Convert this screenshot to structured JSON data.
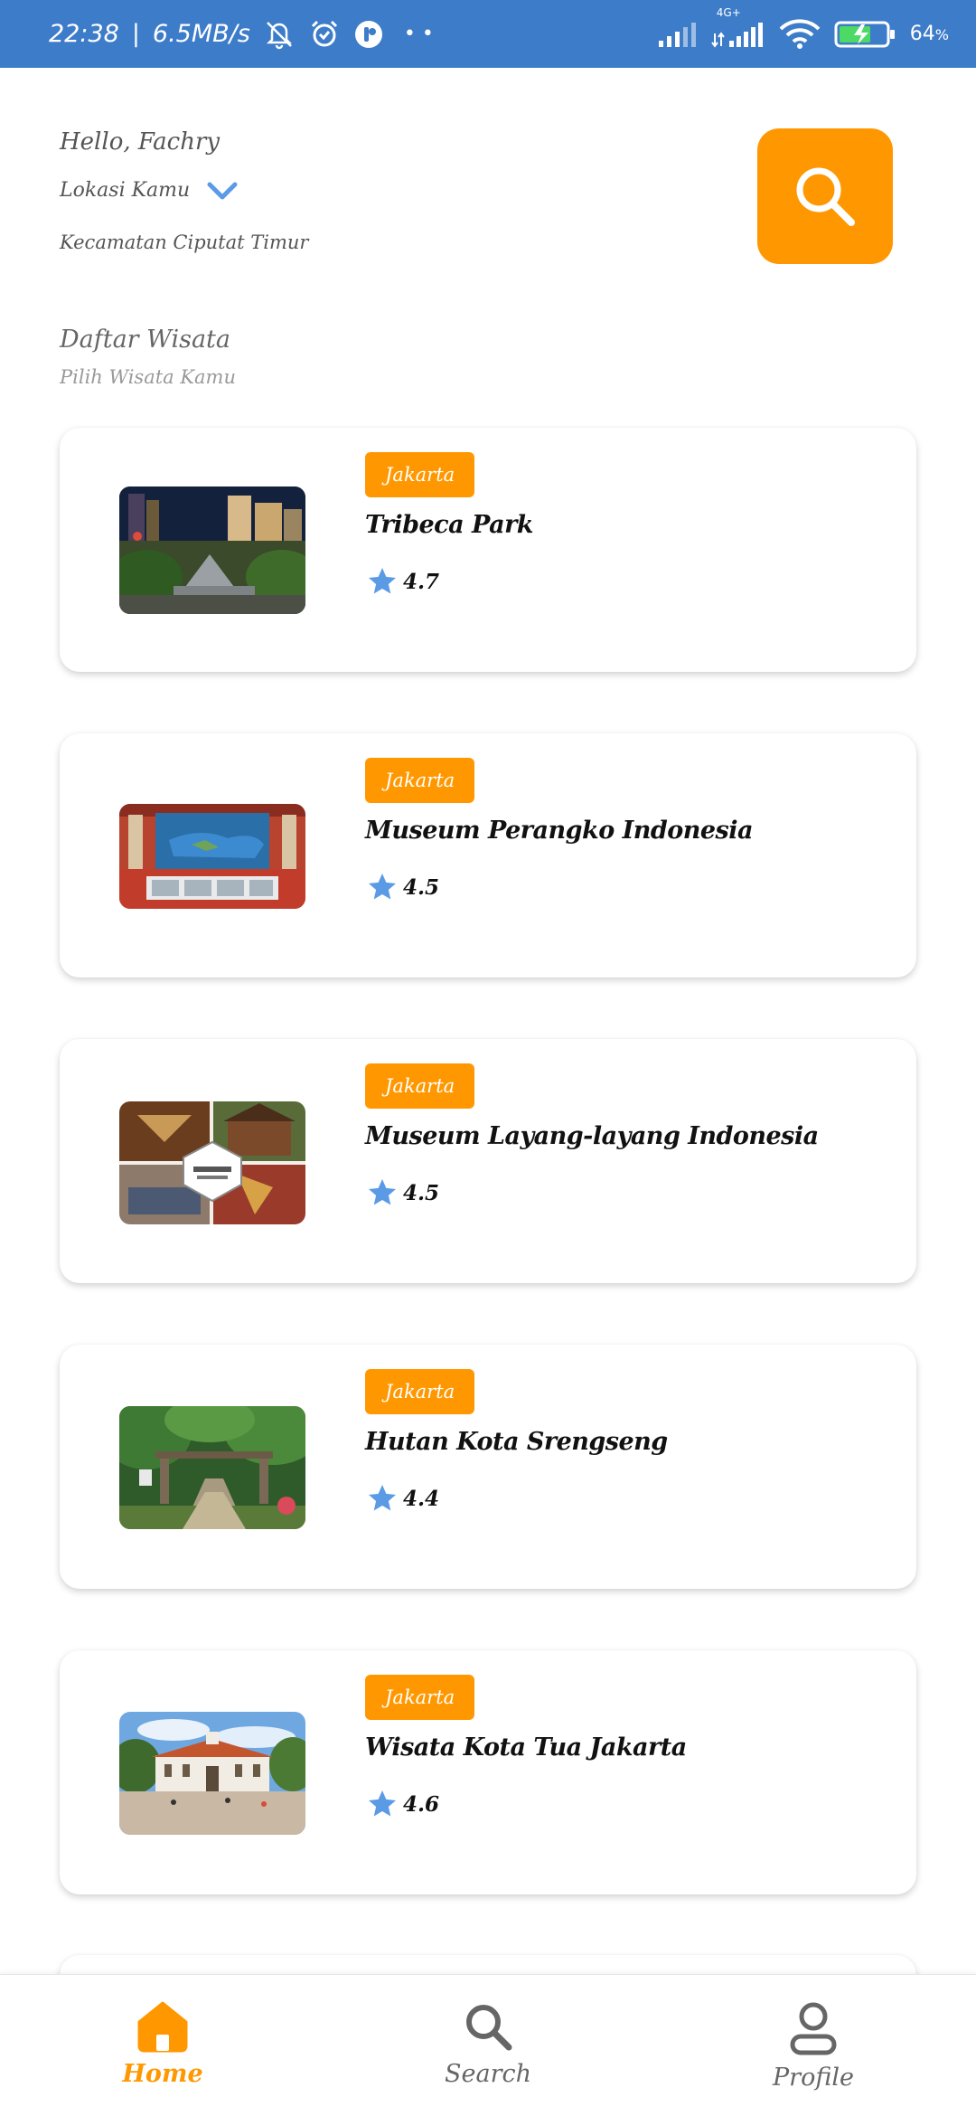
{
  "status_bar": {
    "time": "22:38",
    "separator": "|",
    "speed": "6.5MB/s",
    "dots": "• •",
    "battery": "64",
    "network_type": "4G+",
    "icons": [
      "mute-icon",
      "alarm-icon",
      "app-icon",
      "signal-icon",
      "signal-4g-icon",
      "wifi-icon",
      "battery-charging-icon"
    ]
  },
  "header": {
    "greeting": "Hello, Fachry",
    "location_label": "Lokasi Kamu",
    "district": "Kecamatan Ciputat Timur",
    "search_icon": "search-icon"
  },
  "section": {
    "title": "Daftar Wisata",
    "subtitle": "Pilih Wisata Kamu"
  },
  "places": [
    {
      "city": "Jakarta",
      "name": "Tribeca Park",
      "rating": "4.7"
    },
    {
      "city": "Jakarta",
      "name": "Museum Perangko Indonesia",
      "rating": "4.5"
    },
    {
      "city": "Jakarta",
      "name": "Museum Layang-layang Indonesia",
      "rating": "4.5"
    },
    {
      "city": "Jakarta",
      "name": "Hutan Kota Srengseng",
      "rating": "4.4"
    },
    {
      "city": "Jakarta",
      "name": "Wisata Kota Tua Jakarta",
      "rating": "4.6"
    }
  ],
  "nav": {
    "home": "Home",
    "search": "Search",
    "profile": "Profile",
    "active": "home"
  },
  "colors": {
    "accent": "#ff9800",
    "status_bar": "#3d7cc9",
    "star": "#5b9be6"
  }
}
